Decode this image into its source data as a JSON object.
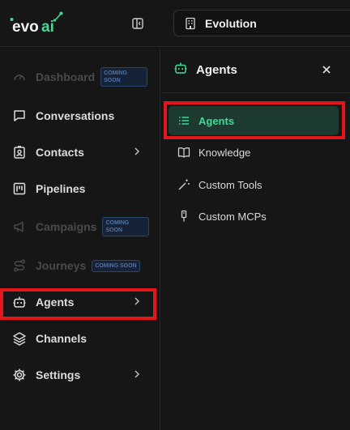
{
  "brand": {
    "name": "evoai",
    "accent": "#3ddc97"
  },
  "workspace": {
    "name": "Evolution",
    "icon": "building-icon"
  },
  "sidebar": {
    "items": [
      {
        "label": "Dashboard",
        "badge": "COMING SOON",
        "disabled": true,
        "icon": "dashboard-icon"
      },
      {
        "label": "Conversations",
        "icon": "chat-icon"
      },
      {
        "label": "Contacts",
        "icon": "contact-card-icon",
        "has_submenu": true
      },
      {
        "label": "Pipelines",
        "icon": "kanban-icon"
      },
      {
        "label": "Campaigns",
        "badge": "COMING SOON",
        "disabled": true,
        "icon": "megaphone-icon"
      },
      {
        "label": "Journeys",
        "badge": "COMING SOON",
        "disabled": true,
        "icon": "route-icon"
      },
      {
        "label": "Agents",
        "icon": "bot-icon",
        "has_submenu": true,
        "selected": true
      },
      {
        "label": "Channels",
        "icon": "layers-icon"
      },
      {
        "label": "Settings",
        "icon": "gear-icon",
        "has_submenu": true
      }
    ]
  },
  "panel": {
    "title": "Agents",
    "icon": "bot-icon",
    "items": [
      {
        "label": "Agents",
        "icon": "list-icon",
        "active": true
      },
      {
        "label": "Knowledge",
        "icon": "book-icon"
      },
      {
        "label": "Custom Tools",
        "icon": "wand-icon"
      },
      {
        "label": "Custom MCPs",
        "icon": "plug-icon"
      }
    ]
  },
  "colors": {
    "highlight": "#e4161d",
    "active_bg": "#1c3a2f",
    "badge_text": "#4f74a8"
  }
}
